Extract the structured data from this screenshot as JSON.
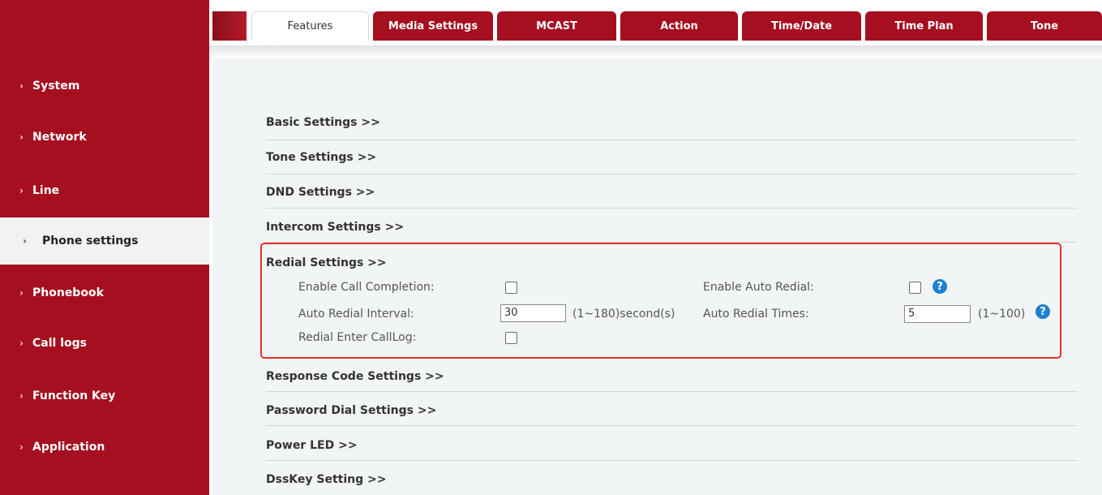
{
  "tabs": [
    "Features",
    "Media Settings",
    "MCAST",
    "Action",
    "Time/Date",
    "Time Plan",
    "Tone"
  ],
  "sidebar": {
    "items": [
      {
        "label": "System"
      },
      {
        "label": "Network"
      },
      {
        "label": "Line"
      },
      {
        "label": "Phone settings"
      },
      {
        "label": "Phonebook"
      },
      {
        "label": "Call logs"
      },
      {
        "label": "Function Key"
      },
      {
        "label": "Application"
      }
    ]
  },
  "sections": {
    "basic": "Basic Settings >>",
    "tone": "Tone Settings >>",
    "dnd": "DND Settings >>",
    "intercom": "Intercom Settings >>",
    "redial": "Redial Settings >>",
    "response": "Response Code Settings >>",
    "password": "Password Dial Settings >>",
    "power": "Power LED >>",
    "dsskey": "DssKey Setting >>"
  },
  "redial": {
    "enable_call_completion_label": "Enable Call Completion:",
    "enable_auto_redial_label": "Enable Auto Redial:",
    "auto_redial_interval_label": "Auto Redial Interval:",
    "auto_redial_interval_value": "30",
    "interval_range": "(1~180)second(s)",
    "auto_redial_times_label": "Auto Redial Times:",
    "auto_redial_times_value": "5",
    "times_range": "(1~100)",
    "redial_enter_calllog_label": "Redial Enter CallLog:"
  },
  "colors": {
    "brand_red": "#a50f20",
    "highlight": "#e8312a",
    "help_blue": "#1f7fd0"
  }
}
